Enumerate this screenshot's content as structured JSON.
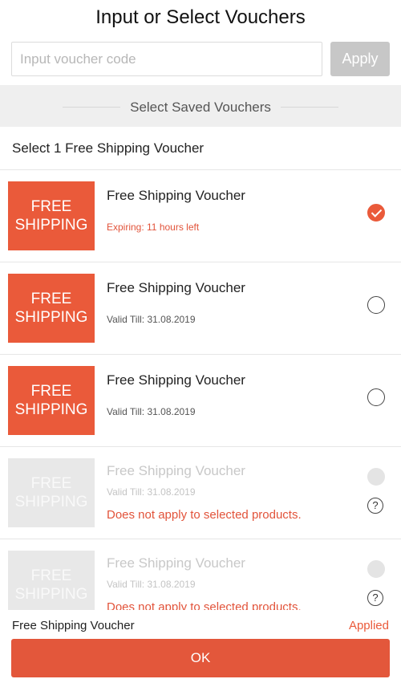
{
  "header": {
    "title": "Input or Select Vouchers"
  },
  "voucher_input": {
    "placeholder": "Input voucher code",
    "value": ""
  },
  "apply_button": {
    "label": "Apply"
  },
  "saved_section": {
    "title": "Select Saved Vouchers"
  },
  "group": {
    "title": "Select 1 Free Shipping Voucher"
  },
  "vouchers": [
    {
      "badge_line1": "FREE",
      "badge_line2": "SHIPPING",
      "title": "Free Shipping Voucher",
      "subtitle": "Expiring: 11 hours left",
      "state": "selected"
    },
    {
      "badge_line1": "FREE",
      "badge_line2": "SHIPPING",
      "title": "Free Shipping Voucher",
      "subtitle": "Valid Till: 31.08.2019",
      "state": "available"
    },
    {
      "badge_line1": "FREE",
      "badge_line2": "SHIPPING",
      "title": "Free Shipping Voucher",
      "subtitle": "Valid Till: 31.08.2019",
      "state": "available"
    },
    {
      "badge_line1": "FREE",
      "badge_line2": "SHIPPING",
      "title": "Free Shipping Voucher",
      "subtitle": "Valid Till: 31.08.2019",
      "warning": "Does not apply to selected products.",
      "help_symbol": "?",
      "state": "disabled"
    },
    {
      "badge_line1": "FREE",
      "badge_line2": "SHIPPING",
      "title": "Free Shipping Voucher",
      "subtitle": "Valid Till: 31.08.2019",
      "warning": "Does not apply to selected products.",
      "help_symbol": "?",
      "state": "disabled"
    }
  ],
  "footer": {
    "label": "Free Shipping Voucher",
    "status": "Applied",
    "ok_label": "OK"
  },
  "colors": {
    "accent": "#ea5a3a",
    "disabled": "#e8e8e8",
    "section_bg": "#efefef"
  }
}
